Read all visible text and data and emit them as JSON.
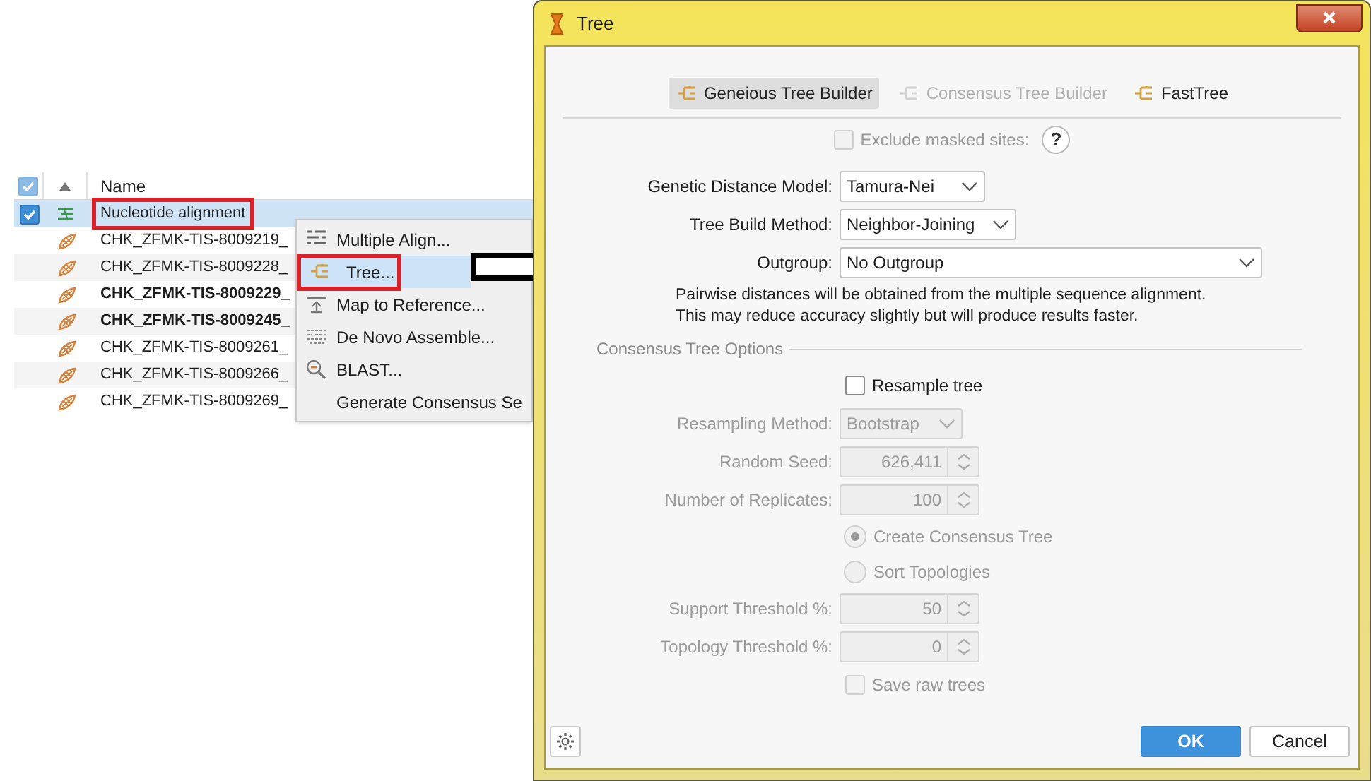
{
  "file_table": {
    "header_checked": true,
    "columns": [
      {
        "label": "Name"
      }
    ],
    "rows": [
      {
        "kind": "alignment",
        "name": "Nucleotide alignment",
        "checked": true,
        "selected": true,
        "unread": false,
        "annotated": true
      },
      {
        "kind": "sequence",
        "name": "CHK_ZFMK-TIS-8009219_",
        "checked": false,
        "selected": false,
        "unread": false,
        "annotated": false
      },
      {
        "kind": "sequence",
        "name": "CHK_ZFMK-TIS-8009228_",
        "checked": false,
        "selected": false,
        "unread": false,
        "annotated": false
      },
      {
        "kind": "sequence",
        "name": "CHK_ZFMK-TIS-8009229_",
        "checked": false,
        "selected": false,
        "unread": true,
        "annotated": false
      },
      {
        "kind": "sequence",
        "name": "CHK_ZFMK-TIS-8009245_",
        "checked": false,
        "selected": false,
        "unread": true,
        "annotated": false
      },
      {
        "kind": "sequence",
        "name": "CHK_ZFMK-TIS-8009261_",
        "checked": false,
        "selected": false,
        "unread": false,
        "annotated": false
      },
      {
        "kind": "sequence",
        "name": "CHK_ZFMK-TIS-8009266_",
        "checked": false,
        "selected": false,
        "unread": false,
        "annotated": false
      },
      {
        "kind": "sequence",
        "name": "CHK_ZFMK-TIS-8009269_",
        "checked": false,
        "selected": false,
        "unread": false,
        "annotated": false
      }
    ]
  },
  "context_menu": [
    {
      "kind": "align",
      "label": "Multiple Align...",
      "selected": false,
      "annotated": false
    },
    {
      "kind": "tree",
      "label": "Tree...",
      "selected": true,
      "annotated": true
    },
    {
      "kind": "map",
      "label": "Map to Reference...",
      "selected": false,
      "annotated": false
    },
    {
      "kind": "assemble",
      "label": "De Novo Assemble...",
      "selected": false,
      "annotated": false
    },
    {
      "kind": "blast",
      "label": "BLAST...",
      "selected": false,
      "annotated": false
    },
    {
      "kind": "plain",
      "label": "Generate Consensus Se",
      "selected": false,
      "annotated": false
    }
  ],
  "dialog": {
    "title": "Tree",
    "tabs": [
      {
        "label": "Geneious Tree Builder",
        "selected": true,
        "disabled": false
      },
      {
        "label": "Consensus Tree Builder",
        "selected": false,
        "disabled": true
      },
      {
        "label": "FastTree",
        "selected": false,
        "disabled": false
      }
    ],
    "exclude_masked": {
      "label": "Exclude masked sites:",
      "checked": false,
      "disabled": true,
      "help": "?"
    },
    "fields": [
      {
        "label": "Genetic Distance Model:",
        "value": "Tamura-Nei"
      },
      {
        "label": "Tree Build Method:",
        "value": "Neighbor-Joining"
      },
      {
        "label": "Outgroup:",
        "value": "No Outgroup"
      }
    ],
    "note": "Pairwise distances will be obtained from the multiple sequence alignment.\nThis may reduce accuracy slightly but will produce results faster.",
    "consensus_section": "Consensus Tree Options",
    "consensus_options": [
      {
        "kind": "checkbox",
        "label": "Resample tree",
        "checked": false,
        "disabled": false
      },
      {
        "kind": "dropdown",
        "label": "Resampling Method:",
        "value": "Bootstrap",
        "disabled": true
      },
      {
        "kind": "spinner",
        "label": "Random Seed:",
        "value": "626,411",
        "disabled": true
      },
      {
        "kind": "spinner",
        "label": "Number of Replicates:",
        "value": "100",
        "disabled": true
      },
      {
        "kind": "radio",
        "label": "Create Consensus Tree",
        "selected": true,
        "disabled": true
      },
      {
        "kind": "radio",
        "label": "Sort Topologies",
        "selected": false,
        "disabled": true
      },
      {
        "kind": "spinner",
        "label": "Support Threshold %:",
        "value": "50",
        "disabled": true
      },
      {
        "kind": "spinner",
        "label": "Topology Threshold %:",
        "value": "0",
        "disabled": true
      },
      {
        "kind": "checkbox",
        "label": "Save raw trees",
        "checked": false,
        "disabled": true
      }
    ],
    "buttons": [
      {
        "label": "OK",
        "kind": "primary"
      },
      {
        "label": "Cancel",
        "kind": "secondary"
      }
    ]
  }
}
